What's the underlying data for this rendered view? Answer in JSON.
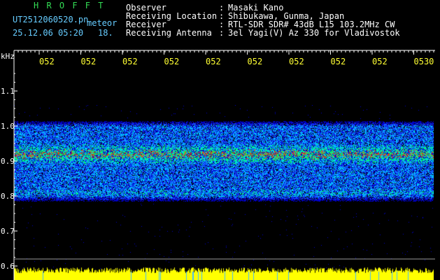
{
  "header": {
    "program": "H R O F F T",
    "filename": "UT2512060520.pn",
    "filename_suffix": "meteor",
    "datetime": "25.12.06 05:20",
    "counter": "18.",
    "fields": [
      {
        "label": "Observer",
        "value": "Masaki Kano"
      },
      {
        "label": "Receiving Location",
        "value": "Shibukawa, Gunma, Japan"
      },
      {
        "label": "Receiver",
        "value": "RTL-SDR SDR# 43dB L15 103.2MHz CW"
      },
      {
        "label": "Receiving Antenna",
        "value": "3el Yagi(V) Az 330 for Vladivostok"
      }
    ],
    "separator": ":"
  },
  "spectrogram": {
    "freq_unit": "kHz",
    "freq_ticks": [
      "1.1",
      "1.0",
      "0.9",
      "0.8",
      "0.7",
      "0.6"
    ],
    "time_ticks": [
      "052",
      "052",
      "052",
      "052",
      "052",
      "052",
      "052",
      "052",
      "052",
      "0530"
    ],
    "signal_band_khz": [
      0.78,
      1.02
    ],
    "carrier_khz": 0.92,
    "colors": {
      "background": "#000000",
      "axis": "#ffffff",
      "time_label": "#ffff33",
      "level_bar": "#ffff00",
      "noise_low": "#0000cc",
      "noise_mid": "#1a4dff",
      "noise_high": "#00ccff",
      "carrier": "#00ff66",
      "carrier_peak": "#ff3300"
    }
  }
}
